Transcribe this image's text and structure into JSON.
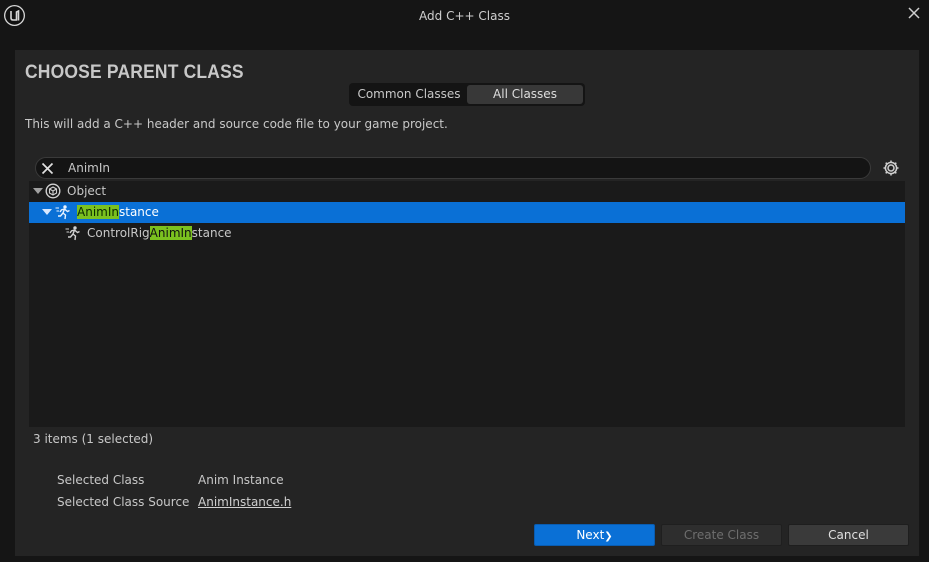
{
  "window": {
    "title": "Add C++ Class",
    "logo_icon": "unreal-logo-icon",
    "close_icon": "close-icon"
  },
  "heading": "CHOOSE PARENT CLASS",
  "tabs": [
    {
      "label": "Common Classes",
      "active": false
    },
    {
      "label": "All Classes",
      "active": true
    }
  ],
  "description": "This will add a C++ header and source code file to your game project.",
  "search": {
    "value": "AnimIn",
    "clear_icon": "clear-icon",
    "settings_icon": "gear-icon"
  },
  "tree": {
    "rows": [
      {
        "label": "Object",
        "prefix": "",
        "match": "",
        "suffix": "",
        "icon": "object-class-icon",
        "expanded": true,
        "selected": false
      },
      {
        "label": "AnimInstance",
        "prefix": "",
        "match": "AnimIn",
        "suffix": "stance",
        "icon": "anim-instance-icon",
        "expanded": true,
        "selected": true
      },
      {
        "label": "ControlRigAnimInstance",
        "prefix": "ControlRig",
        "match": "AnimIn",
        "suffix": "stance",
        "icon": "anim-instance-icon",
        "expanded": false,
        "selected": false
      }
    ]
  },
  "item_count": "3 items (1 selected)",
  "selected_class": {
    "label": "Selected Class",
    "value": "Anim Instance"
  },
  "selected_class_source": {
    "label": "Selected Class Source",
    "value": "AnimInstance.h"
  },
  "buttons": {
    "next": "Next",
    "create": "Create Class",
    "cancel": "Cancel"
  },
  "colors": {
    "accent": "#0a70d6",
    "highlight": "#7bc11f",
    "panel": "#242424",
    "background": "#151515"
  }
}
